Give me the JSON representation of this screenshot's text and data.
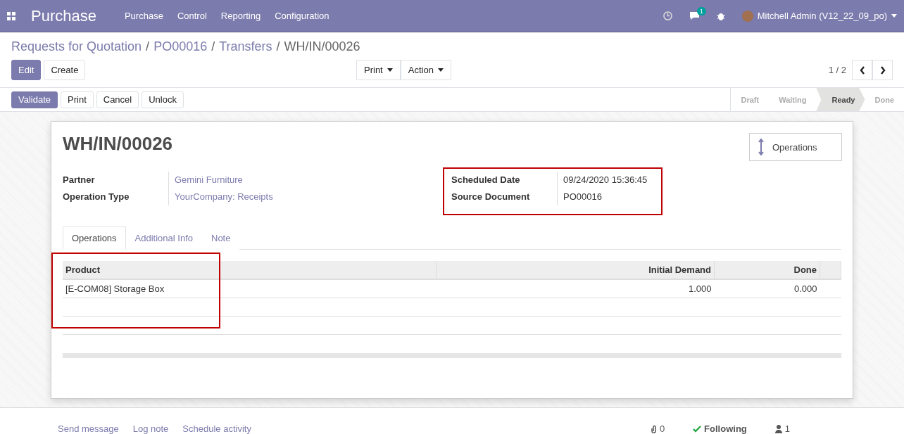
{
  "navbar": {
    "app_title": "Purchase",
    "menus": [
      "Purchase",
      "Control",
      "Reporting",
      "Configuration"
    ],
    "message_count": "1",
    "user": "Mitchell Admin (V12_22_09_po)"
  },
  "breadcrumbs": [
    {
      "label": "Requests for Quotation",
      "link": true
    },
    {
      "separator": "/",
      "label": "PO00016",
      "link": true
    },
    {
      "separator": "/",
      "label": "Transfers",
      "link": true
    },
    {
      "separator": "/",
      "label": "WH/IN/00026",
      "link": false
    }
  ],
  "main_buttons": [
    {
      "label": "Edit",
      "primary": true
    },
    {
      "label": "Create",
      "primary": false
    }
  ],
  "dropdowns": [
    "Print",
    "Action"
  ],
  "pager": "1 / 2",
  "action_buttons": [
    {
      "label": "Validate",
      "primary": true
    },
    {
      "label": "Print",
      "primary": false
    },
    {
      "label": "Cancel",
      "primary": false
    },
    {
      "label": "Unlock",
      "primary": false
    }
  ],
  "status_steps": [
    {
      "label": "Draft",
      "selected": false
    },
    {
      "label": "Waiting",
      "selected": false
    },
    {
      "label": "Ready",
      "selected": true
    },
    {
      "label": "Done",
      "selected": false
    }
  ],
  "record": {
    "title": "WH/IN/00026",
    "smart_button": "Operations",
    "left_fields": [
      {
        "label": "Partner",
        "value": "Gemini Furniture",
        "link": true
      },
      {
        "label": "Operation Type",
        "value": "YourCompany: Receipts",
        "link": true
      }
    ],
    "right_fields": [
      {
        "label": "Scheduled Date",
        "value": "09/24/2020 15:36:45",
        "link": false
      },
      {
        "label": "Source Document",
        "value": "PO00016",
        "link": false
      }
    ]
  },
  "tabs": [
    {
      "label": "Operations",
      "selected": true
    },
    {
      "label": "Additional Info",
      "selected": false
    },
    {
      "label": "Note",
      "selected": false
    }
  ],
  "table": {
    "columns": [
      "Product",
      "Initial Demand",
      "Done"
    ],
    "rows": [
      [
        "[E-COM08] Storage Box",
        "1.000",
        "0.000"
      ]
    ]
  },
  "chatter": {
    "actions": [
      "Send message",
      "Log note",
      "Schedule activity"
    ],
    "attachments": "0",
    "follow": "Following",
    "followers": "1"
  }
}
